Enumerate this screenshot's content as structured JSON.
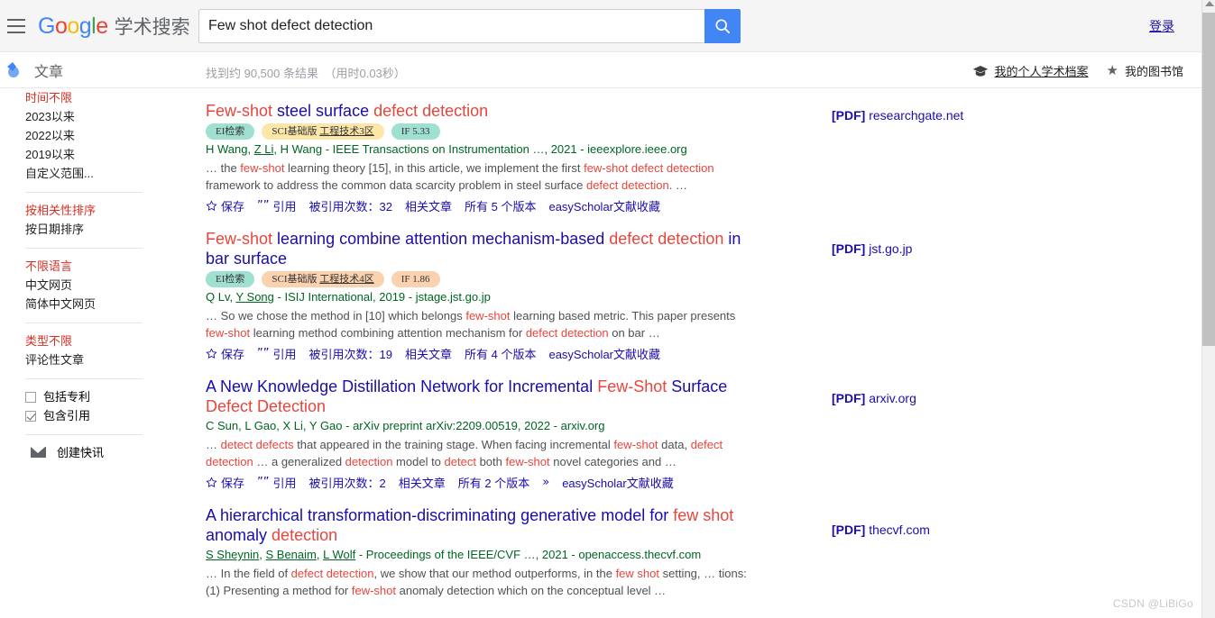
{
  "header": {
    "menu_icon": "hamburger-icon",
    "logo": {
      "g1": "G",
      "o1": "o",
      "o2": "o",
      "g2": "g",
      "l": "l",
      "e": "e",
      "suffix": "学术搜索"
    },
    "search": {
      "value": "Few shot defect detection",
      "placeholder": "",
      "button_icon": "search-icon"
    },
    "login_label": "登录"
  },
  "subbar": {
    "articles_label": "文章",
    "results_meta": "找到约 90,500 条结果　（用时0.03秒）",
    "profile_label": "我的个人学术档案",
    "library_label": "我的图书馆"
  },
  "sidebar": {
    "time_group": [
      {
        "label": "时间不限",
        "active": true
      },
      {
        "label": "2023以来",
        "active": false
      },
      {
        "label": "2022以来",
        "active": false
      },
      {
        "label": "2019以来",
        "active": false
      },
      {
        "label": "自定义范围...",
        "active": false
      }
    ],
    "sort_group": [
      {
        "label": "按相关性排序",
        "active": true
      },
      {
        "label": "按日期排序",
        "active": false
      }
    ],
    "lang_group": [
      {
        "label": "不限语言",
        "active": true
      },
      {
        "label": "中文网页",
        "active": false
      },
      {
        "label": "简体中文网页",
        "active": false
      }
    ],
    "type_group": [
      {
        "label": "类型不限",
        "active": true
      },
      {
        "label": "评论性文章",
        "active": false
      }
    ],
    "checkboxes": [
      {
        "label": "包括专利",
        "checked": false
      },
      {
        "label": "包含引用",
        "checked": true
      }
    ],
    "alert_label": "创建快讯"
  },
  "results": [
    {
      "title_parts": [
        {
          "t": "Few-shot ",
          "hl": true
        },
        {
          "t": "steel surface ",
          "hl": false
        },
        {
          "t": "defect detection",
          "hl": true
        }
      ],
      "badges": [
        {
          "label": "EI检索",
          "bg": "#9fe0d0",
          "underline": false
        },
        {
          "label": "SCI基础版 ",
          "label2": "工程技术3区",
          "bg": "#fce6a8",
          "underline": true
        },
        {
          "label": "IF 5.33",
          "bg": "#9fe0d0",
          "underline": false
        }
      ],
      "authors_parts": [
        {
          "t": "H Wang, ",
          "link": false
        },
        {
          "t": "Z Li",
          "link": true
        },
        {
          "t": ", H Wang - IEEE Transactions on Instrumentation …, 2021 - ieeexplore.ieee.org",
          "link": false
        }
      ],
      "snippet_parts": [
        {
          "t": "… the ",
          "hl": false
        },
        {
          "t": "few-shot",
          "hl": true
        },
        {
          "t": " learning theory [15], in this article, we implement the first ",
          "hl": false
        },
        {
          "t": "few-shot defect detection",
          "hl": true
        },
        {
          "t": " framework to address the common data scarcity problem in steel surface ",
          "hl": false
        },
        {
          "t": "defect detection",
          "hl": true
        },
        {
          "t": ". …",
          "hl": false
        }
      ],
      "actions": [
        {
          "icon": "star-icon",
          "label": "保存"
        },
        {
          "icon": "quote-icon",
          "label": "引用"
        },
        {
          "icon": "",
          "label": "被引用次数：32"
        },
        {
          "icon": "",
          "label": "相关文章"
        },
        {
          "icon": "",
          "label": "所有 5 个版本"
        },
        {
          "icon": "",
          "label": "easyScholar文献收藏"
        }
      ],
      "pdf": {
        "tag": "[PDF]",
        "domain": "researchgate.net"
      }
    },
    {
      "title_parts": [
        {
          "t": "Few-shot ",
          "hl": true
        },
        {
          "t": "learning combine attention mechanism-based ",
          "hl": false
        },
        {
          "t": "defect detection",
          "hl": true
        },
        {
          "t": " in bar surface",
          "hl": false
        }
      ],
      "badges": [
        {
          "label": "EI检索",
          "bg": "#9fe0d0",
          "underline": false
        },
        {
          "label": "SCI基础版 ",
          "label2": "工程技术4区",
          "bg": "#fbd2b0",
          "underline": true
        },
        {
          "label": "IF 1.86",
          "bg": "#fbd2b0",
          "underline": false
        }
      ],
      "authors_parts": [
        {
          "t": "Q Lv, ",
          "link": false
        },
        {
          "t": "Y Song",
          "link": true
        },
        {
          "t": " - ISIJ International, 2019 - jstage.jst.go.jp",
          "link": false
        }
      ],
      "snippet_parts": [
        {
          "t": "… So we chose the method in [10] which belongs ",
          "hl": false
        },
        {
          "t": "few-shot",
          "hl": true
        },
        {
          "t": " learning based metric. This paper presents ",
          "hl": false
        },
        {
          "t": "few-shot",
          "hl": true
        },
        {
          "t": " learning method combining attention mechanism for ",
          "hl": false
        },
        {
          "t": "defect detection",
          "hl": true
        },
        {
          "t": " on bar …",
          "hl": false
        }
      ],
      "actions": [
        {
          "icon": "star-icon",
          "label": "保存"
        },
        {
          "icon": "quote-icon",
          "label": "引用"
        },
        {
          "icon": "",
          "label": "被引用次数：19"
        },
        {
          "icon": "",
          "label": "相关文章"
        },
        {
          "icon": "",
          "label": "所有 4 个版本"
        },
        {
          "icon": "",
          "label": "easyScholar文献收藏"
        }
      ],
      "pdf": {
        "tag": "[PDF]",
        "domain": "jst.go.jp"
      }
    },
    {
      "title_parts": [
        {
          "t": "A New Knowledge Distillation Network for Incremental ",
          "hl": false
        },
        {
          "t": "Few-Shot",
          "hl": true
        },
        {
          "t": " Surface ",
          "hl": false
        },
        {
          "t": "Defect Detection",
          "hl": true
        }
      ],
      "badges": [],
      "authors_parts": [
        {
          "t": "C Sun, L Gao, X Li, Y Gao - arXiv preprint arXiv:2209.00519, 2022 - arxiv.org",
          "link": false
        }
      ],
      "snippet_parts": [
        {
          "t": "… ",
          "hl": false
        },
        {
          "t": "detect defects",
          "hl": true
        },
        {
          "t": " that appeared in the training stage. When facing incremental ",
          "hl": false
        },
        {
          "t": "few-shot",
          "hl": true
        },
        {
          "t": " data, ",
          "hl": false
        },
        {
          "t": "defect detection",
          "hl": true
        },
        {
          "t": " … a generalized ",
          "hl": false
        },
        {
          "t": "detection",
          "hl": true
        },
        {
          "t": " model to ",
          "hl": false
        },
        {
          "t": "detect",
          "hl": true
        },
        {
          "t": " both ",
          "hl": false
        },
        {
          "t": "few-shot",
          "hl": true
        },
        {
          "t": " novel categories and …",
          "hl": false
        }
      ],
      "actions": [
        {
          "icon": "star-icon",
          "label": "保存"
        },
        {
          "icon": "quote-icon",
          "label": "引用"
        },
        {
          "icon": "",
          "label": "被引用次数：2"
        },
        {
          "icon": "",
          "label": "相关文章"
        },
        {
          "icon": "",
          "label": "所有 2 个版本"
        },
        {
          "icon": "more-icon",
          "label": ""
        },
        {
          "icon": "",
          "label": "easyScholar文献收藏"
        }
      ],
      "pdf": {
        "tag": "[PDF]",
        "domain": "arxiv.org"
      }
    },
    {
      "title_parts": [
        {
          "t": "A hierarchical transformation-discriminating generative model for ",
          "hl": false
        },
        {
          "t": "few shot",
          "hl": true
        },
        {
          "t": " anomaly ",
          "hl": false
        },
        {
          "t": "detection",
          "hl": true
        }
      ],
      "badges": [],
      "authors_parts": [
        {
          "t": "S Sheynin",
          "link": true
        },
        {
          "t": ", ",
          "link": false
        },
        {
          "t": "S Benaim",
          "link": true
        },
        {
          "t": ", ",
          "link": false
        },
        {
          "t": "L Wolf",
          "link": true
        },
        {
          "t": " - Proceedings of the IEEE/CVF …, 2021 - openaccess.thecvf.com",
          "link": false
        }
      ],
      "snippet_parts": [
        {
          "t": "… In the field of ",
          "hl": false
        },
        {
          "t": "defect detection",
          "hl": true
        },
        {
          "t": ", we show that our method outperforms, in the ",
          "hl": false
        },
        {
          "t": "few shot",
          "hl": true
        },
        {
          "t": " setting, ",
          "hl": false
        },
        {
          "t": "… tions: (1) Presenting a method for ",
          "hl": false
        },
        {
          "t": "few-shot",
          "hl": true
        },
        {
          "t": " anomaly detection which on the conceptual level …",
          "hl": false
        }
      ],
      "actions": [],
      "pdf": {
        "tag": "[PDF]",
        "domain": "thecvf.com"
      }
    }
  ],
  "watermark": "CSDN @LiBiGo"
}
